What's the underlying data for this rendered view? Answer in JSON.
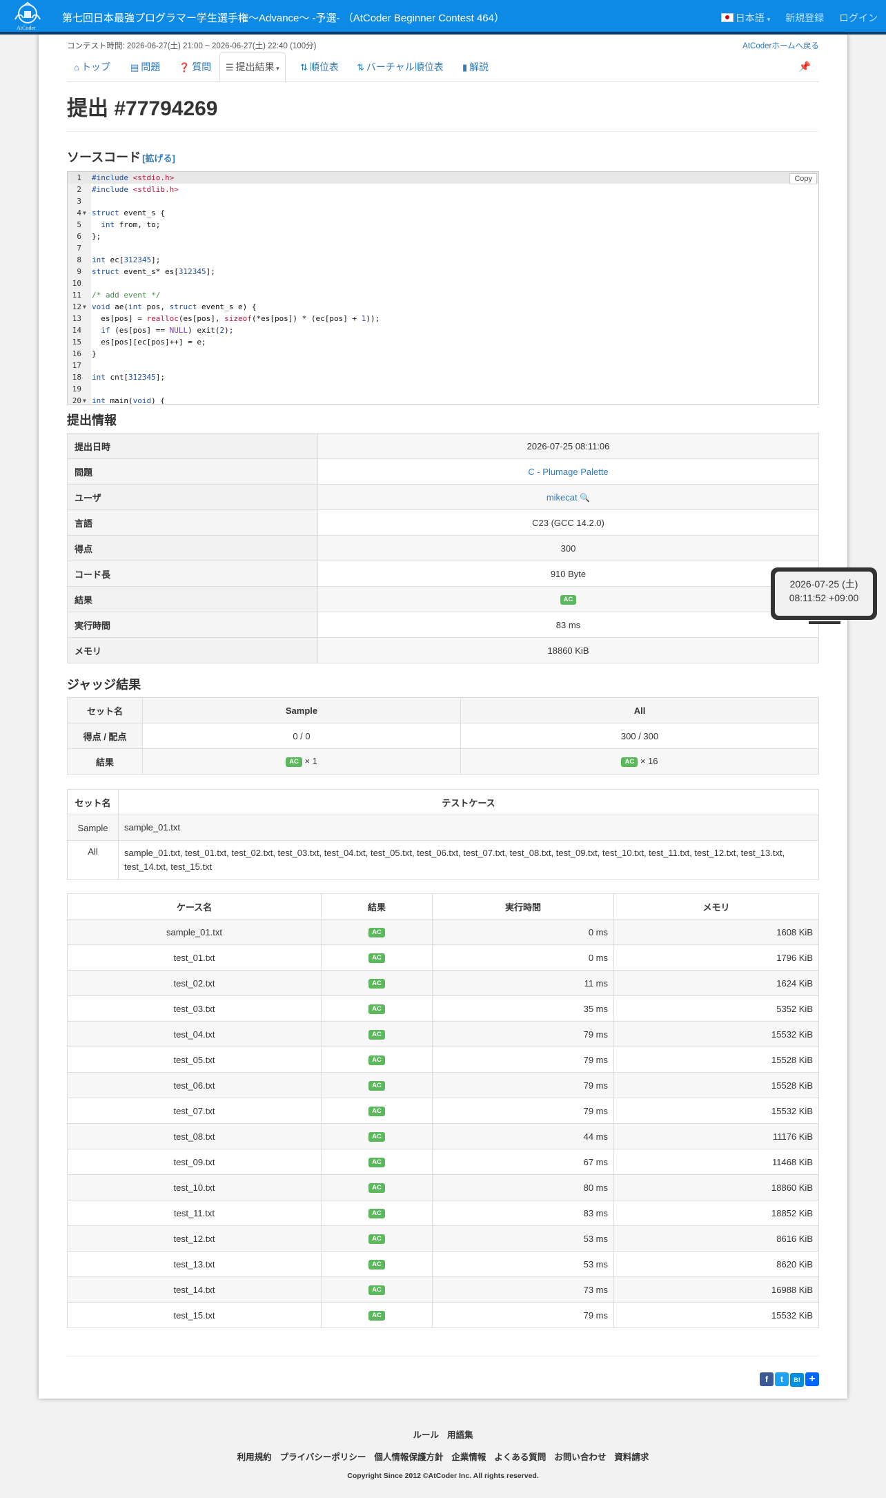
{
  "header": {
    "title": "第七回日本最強プログラマー学生選手権〜Advance〜 -予選- （AtCoder Beginner Contest 464）",
    "language": "日本語",
    "signup": "新規登録",
    "login": "ログイン",
    "logo_text": "AtCoder"
  },
  "contest": {
    "time": "コンテスト時間: 2026-06-27(土) 21:00 ~ 2026-06-27(土) 22:40 (100分)",
    "home_link": "AtCoderホームへ戻る"
  },
  "tabs": [
    {
      "label": "トップ",
      "icon": "home-icon"
    },
    {
      "label": "問題",
      "icon": "list-icon"
    },
    {
      "label": "質問",
      "icon": "question-icon"
    },
    {
      "label": "提出結果",
      "icon": "list-icon"
    },
    {
      "label": "順位表",
      "icon": "sort-icon"
    },
    {
      "label": "バーチャル順位表",
      "icon": "sort-icon"
    },
    {
      "label": "解説",
      "icon": "book-icon"
    }
  ],
  "page_title": "提出 #77794269",
  "source": {
    "heading": "ソースコード",
    "expand": "[拡げる]",
    "copy": "Copy"
  },
  "info": {
    "heading": "提出情報",
    "rows": [
      {
        "key": "提出日時",
        "value": "2026-07-25 08:11:06"
      },
      {
        "key": "問題",
        "value": "C - Plumage Palette"
      },
      {
        "key": "ユーザ",
        "value": "mikecat"
      },
      {
        "key": "言語",
        "value": "C23 (GCC 14.2.0)"
      },
      {
        "key": "得点",
        "value": "300"
      },
      {
        "key": "コード長",
        "value": "910 Byte"
      },
      {
        "key": "結果",
        "value": "AC"
      },
      {
        "key": "実行時間",
        "value": "83 ms"
      },
      {
        "key": "メモリ",
        "value": "18860 KiB"
      }
    ]
  },
  "tooltip": {
    "line1": "2026-07-25 (土)",
    "line2": "08:11:52 +09:00"
  },
  "judge": {
    "heading": "ジャッジ結果",
    "set_name": "セット名",
    "sample": "Sample",
    "all": "All",
    "score_label": "得点 / 配点",
    "sample_score": "0 / 0",
    "all_score": "300 / 300",
    "result_label": "結果",
    "ac": "AC",
    "sample_count": "× 1",
    "all_count": "× 16"
  },
  "sets": {
    "set_name": "セット名",
    "testcase": "テストケース",
    "rows": [
      {
        "name": "Sample",
        "cases": "sample_01.txt"
      },
      {
        "name": "All",
        "cases": "sample_01.txt, test_01.txt, test_02.txt, test_03.txt, test_04.txt, test_05.txt, test_06.txt, test_07.txt, test_08.txt, test_09.txt, test_10.txt, test_11.txt, test_12.txt, test_13.txt, test_14.txt, test_15.txt"
      }
    ]
  },
  "cases": {
    "headers": [
      "ケース名",
      "結果",
      "実行時間",
      "メモリ"
    ],
    "rows": [
      [
        "sample_01.txt",
        "AC",
        "0 ms",
        "1608 KiB"
      ],
      [
        "test_01.txt",
        "AC",
        "0 ms",
        "1796 KiB"
      ],
      [
        "test_02.txt",
        "AC",
        "11 ms",
        "1624 KiB"
      ],
      [
        "test_03.txt",
        "AC",
        "35 ms",
        "5352 KiB"
      ],
      [
        "test_04.txt",
        "AC",
        "79 ms",
        "15532 KiB"
      ],
      [
        "test_05.txt",
        "AC",
        "79 ms",
        "15528 KiB"
      ],
      [
        "test_06.txt",
        "AC",
        "79 ms",
        "15528 KiB"
      ],
      [
        "test_07.txt",
        "AC",
        "79 ms",
        "15532 KiB"
      ],
      [
        "test_08.txt",
        "AC",
        "44 ms",
        "11176 KiB"
      ],
      [
        "test_09.txt",
        "AC",
        "67 ms",
        "11468 KiB"
      ],
      [
        "test_10.txt",
        "AC",
        "80 ms",
        "18860 KiB"
      ],
      [
        "test_11.txt",
        "AC",
        "83 ms",
        "18852 KiB"
      ],
      [
        "test_12.txt",
        "AC",
        "53 ms",
        "8616 KiB"
      ],
      [
        "test_13.txt",
        "AC",
        "53 ms",
        "8620 KiB"
      ],
      [
        "test_14.txt",
        "AC",
        "73 ms",
        "16988 KiB"
      ],
      [
        "test_15.txt",
        "AC",
        "79 ms",
        "15532 KiB"
      ]
    ]
  },
  "footer": {
    "links1": [
      "ルール",
      "用語集"
    ],
    "links2": [
      "利用規約",
      "プライバシーポリシー",
      "個人情報保護方針",
      "企業情報",
      "よくある質問",
      "お問い合わせ",
      "資料請求"
    ],
    "copyright": "Copyright Since 2012 ©AtCoder Inc. All rights reserved."
  },
  "colors": {
    "header_bg": "#0d8ae6",
    "header_border": "#0b3f71",
    "ac_badge": "#5cb85c",
    "link": "#337ab7"
  }
}
